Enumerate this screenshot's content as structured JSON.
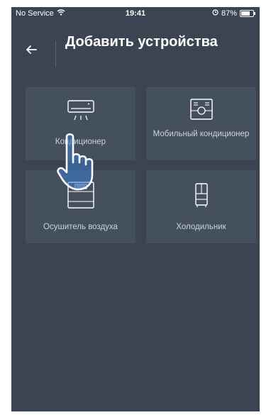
{
  "status_bar": {
    "carrier": "No Service",
    "time": "19:41",
    "battery_label": "87%",
    "battery_level": 0.87
  },
  "header": {
    "title": "Добавить устройства",
    "back_icon": "arrow-left-icon"
  },
  "devices": [
    {
      "label": "Кондиционер",
      "icon": "air-conditioner-icon"
    },
    {
      "label": "Мобильный кондиционер",
      "icon": "mobile-air-conditioner-icon"
    },
    {
      "label": "Осушитель воздуха",
      "icon": "dehumidifier-icon"
    },
    {
      "label": "Холодильник",
      "icon": "refrigerator-icon"
    }
  ],
  "overlay": {
    "icon": "tap-hand-icon"
  },
  "colors": {
    "background": "#3a4453",
    "tile": "#45505f",
    "text": "#ffffff",
    "tile_text": "#cdd2d9"
  }
}
